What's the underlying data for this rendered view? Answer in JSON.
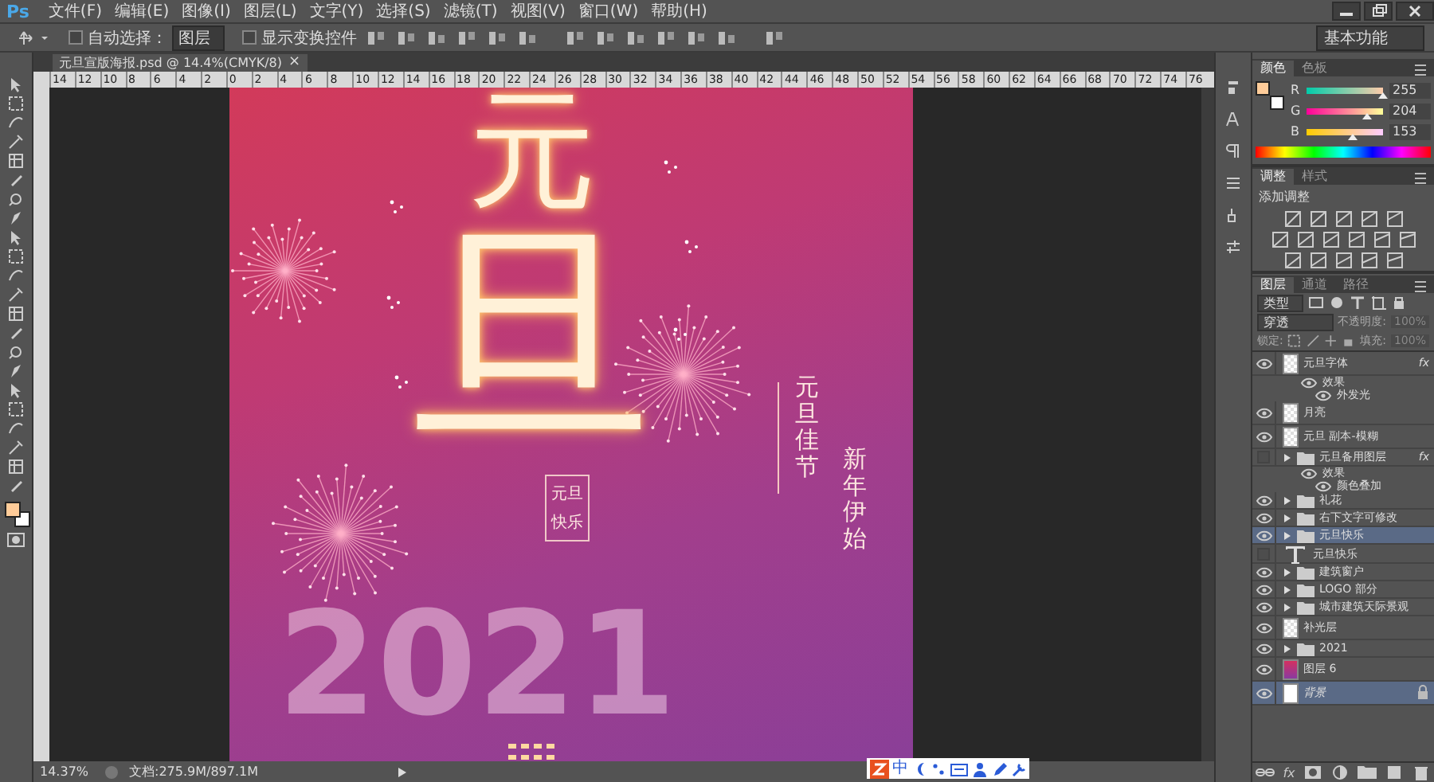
{
  "app_logo": "Ps",
  "menu": [
    "文件(F)",
    "编辑(E)",
    "图像(I)",
    "图层(L)",
    "文字(Y)",
    "选择(S)",
    "滤镜(T)",
    "视图(V)",
    "窗口(W)",
    "帮助(H)"
  ],
  "options_bar": {
    "auto_select": {
      "label": "自动选择：",
      "checked": false
    },
    "target": "图层",
    "show_transform": {
      "label": "显示变换控件",
      "checked": false
    },
    "workspace": "基本功能"
  },
  "document": {
    "tab_title": "元旦宣版海报.psd @ 14.4%(CMYK/8)",
    "close": "×",
    "ruler": [
      "14",
      "12",
      "10",
      "8",
      "6",
      "4",
      "2",
      "0",
      "2",
      "4",
      "6",
      "8",
      "10",
      "12",
      "14",
      "16",
      "18",
      "20",
      "22",
      "24",
      "26",
      "28",
      "30",
      "32",
      "34",
      "36",
      "38",
      "40",
      "42",
      "44",
      "46",
      "48",
      "50",
      "52",
      "54",
      "56",
      "58",
      "60",
      "62",
      "64",
      "66",
      "68",
      "70",
      "72",
      "74",
      "76"
    ],
    "zoom": "14.37%",
    "doc_size": "文档:275.9M/897.1M"
  },
  "poster": {
    "title_chars": [
      "元",
      "旦"
    ],
    "slogans": [
      "元旦佳节",
      "新年伊始"
    ],
    "stamp": [
      "元旦",
      "快乐"
    ],
    "year": "2021"
  },
  "ime": {
    "label": "中"
  },
  "color_panel": {
    "tabs": [
      {
        "label": "颜色",
        "selected": true
      },
      {
        "label": "色板",
        "selected": false
      }
    ],
    "channels": [
      {
        "name": "R",
        "value": "255",
        "level": 1
      },
      {
        "name": "G",
        "value": "204",
        "level": 0.8
      },
      {
        "name": "B",
        "value": "153",
        "level": 0.6
      }
    ]
  },
  "adjust_panel": {
    "tabs": [
      {
        "label": "调整",
        "selected": true
      },
      {
        "label": "样式",
        "selected": false
      }
    ],
    "heading": "添加调整"
  },
  "layers_panel": {
    "tabs": [
      {
        "label": "图层",
        "selected": true
      },
      {
        "label": "通道",
        "selected": false
      },
      {
        "label": "路径",
        "selected": false
      }
    ],
    "filter": "类型",
    "blend": "穿透",
    "opacity_label": "不透明度:",
    "opacity": "100%",
    "lock_label": "锁定:",
    "fill_label": "填充:",
    "fill": "100%",
    "fx_label": "fx",
    "layers": [
      {
        "kind": "image",
        "name": "元旦字体",
        "visible": true,
        "selected": false,
        "fx": "fx",
        "children": [
          {
            "name": "效果",
            "children": [
              {
                "name": "外发光"
              }
            ]
          }
        ]
      },
      {
        "kind": "image",
        "name": "月亮",
        "visible": true,
        "selected": false
      },
      {
        "kind": "image",
        "name": "元旦 副本-模糊",
        "visible": true,
        "selected": false
      },
      {
        "kind": "folder",
        "name": "元旦备用图层",
        "visible": false,
        "selected": false,
        "fx": "fx",
        "children": [
          {
            "name": "效果",
            "children": [
              {
                "name": "颜色叠加"
              }
            ]
          }
        ]
      },
      {
        "kind": "folder",
        "name": "礼花",
        "visible": true,
        "selected": false
      },
      {
        "kind": "folder",
        "name": "右下文字可修改",
        "visible": true,
        "selected": false
      },
      {
        "kind": "folder",
        "name": "元旦快乐",
        "visible": true,
        "selected": true
      },
      {
        "kind": "text",
        "name": "元旦快乐",
        "visible": false,
        "selected": false
      },
      {
        "kind": "folder",
        "name": "建筑窗户",
        "visible": true,
        "selected": false
      },
      {
        "kind": "folder",
        "name": "LOGO 部分",
        "visible": true,
        "selected": false
      },
      {
        "kind": "folder",
        "name": "城市建筑天际景观",
        "visible": true,
        "selected": false
      },
      {
        "kind": "image",
        "name": "补光层",
        "visible": true,
        "selected": false
      },
      {
        "kind": "folder",
        "name": "2021",
        "visible": true,
        "selected": false
      },
      {
        "kind": "fill",
        "name": "图层 6",
        "visible": true,
        "selected": false
      },
      {
        "kind": "background",
        "name": "背景",
        "visible": true,
        "selected": true,
        "locked": true
      }
    ]
  }
}
